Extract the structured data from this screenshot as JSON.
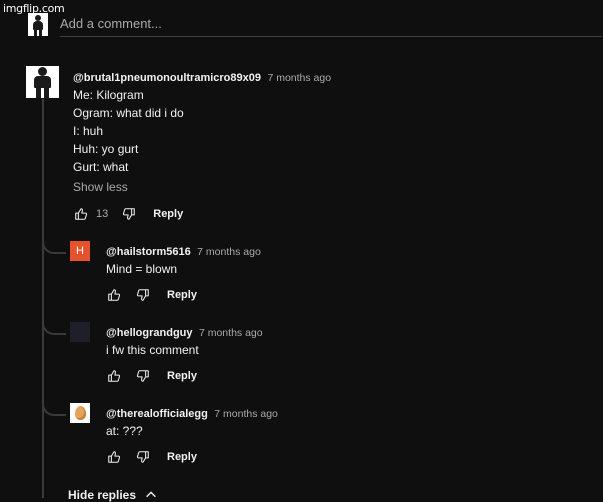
{
  "watermark": "imgflip.com",
  "comment_box": {
    "placeholder": "Add a comment..."
  },
  "main_comment": {
    "handle": "@brutal1pneumonoultramicro89x09",
    "time": "7 months ago",
    "lines": [
      "Me: Kilogram",
      "Ogram: what did i do",
      "I: huh",
      "Huh: yo gurt",
      "Gurt: what"
    ],
    "show_less": "Show less",
    "likes": "13",
    "reply_label": "Reply"
  },
  "replies": [
    {
      "handle": "@hailstorm5616",
      "time": "7 months ago",
      "text": "Mind = blown",
      "avatar_letter": "H",
      "avatar_color": "#e5532d",
      "reply_label": "Reply"
    },
    {
      "handle": "@hellograndguy",
      "time": "7 months ago",
      "text": "i fw this comment",
      "avatar_color": "#1f1f2a",
      "reply_label": "Reply"
    },
    {
      "handle": "@therealofficialegg",
      "time": "7 months ago",
      "text": "at: ???",
      "avatar_color": "#ffffff",
      "reply_label": "Reply"
    }
  ],
  "hide_replies": "Hide replies",
  "icons": {
    "like": "thumbs-up-icon",
    "dislike": "thumbs-down-icon",
    "collapse": "chevron-up-icon"
  }
}
